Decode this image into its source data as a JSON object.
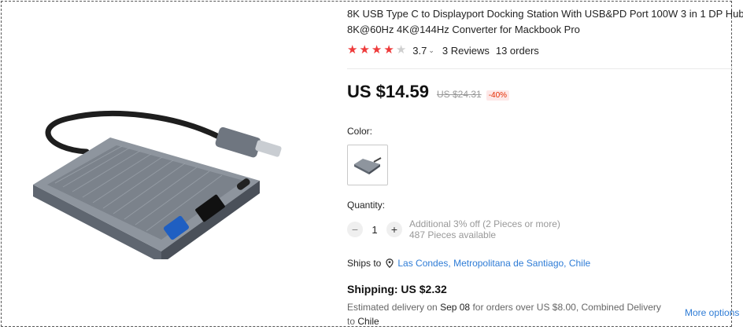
{
  "product": {
    "title": "8K USB Type C to Displayport Docking Station With USB&PD Port 100W 3 in 1 DP Hub 8K@60Hz 4K@144Hz Converter for Mackbook Pro",
    "image_alt": "USB-C docking station hub"
  },
  "rating": {
    "value": "3.7",
    "stars_filled": 3.7,
    "stars_total": 5,
    "reviews": "3 Reviews",
    "orders": "13 orders",
    "star_color": "#ee3a3a"
  },
  "price": {
    "current": "US $14.59",
    "original": "US $24.31",
    "discount": "-40%"
  },
  "color": {
    "label": "Color:",
    "selected_icon": "hub-thumbnail"
  },
  "quantity": {
    "label": "Quantity:",
    "value": "1",
    "minus": "−",
    "plus": "+",
    "offer": "Additional 3% off (2 Pieces or more)",
    "available": "487 Pieces available"
  },
  "shipping": {
    "ships_to_label": "Ships to",
    "location": "Las Condes, Metropolitana de Santiago, Chile",
    "cost": "Shipping: US $2.32",
    "est_prefix": "Estimated delivery on ",
    "est_date": "Sep 08",
    "est_suffix": " for orders over US $8.00, Combined Delivery",
    "est_to": "to ",
    "est_dest": "Chile",
    "more_options": "More options"
  },
  "colors": {
    "link": "#2e7cd6",
    "discount": "#e62e04"
  }
}
